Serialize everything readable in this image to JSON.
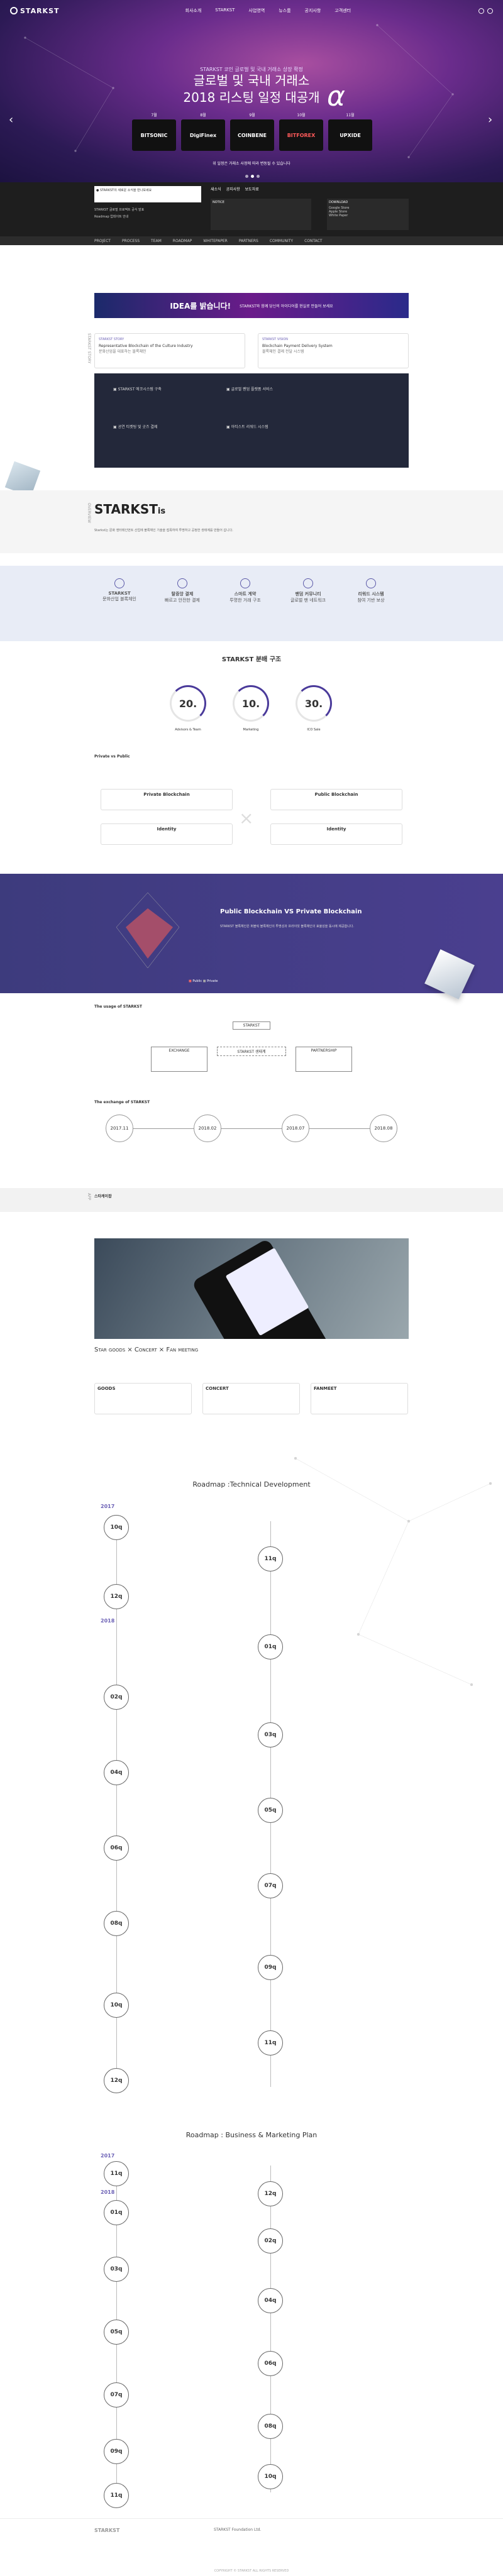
{
  "nav": {
    "logo": "STARKST",
    "menu": [
      "회사소개",
      "STARKST",
      "사업영역",
      "뉴스룸",
      "공지사항",
      "고객센터"
    ]
  },
  "hero": {
    "subtitle": "STARKST 코인 글로벌 및 국내 거래소 상장 확정",
    "title_line1": "글로벌 및 국내 거래소",
    "title_line2": "2018 리스팅 일정 대공개",
    "alpha": "α",
    "exchanges": [
      {
        "tag": "7월",
        "name": "BITSONIC"
      },
      {
        "tag": "8월",
        "name": "DigiFinex"
      },
      {
        "tag": "9월",
        "name": "COINBENE"
      },
      {
        "tag": "10월",
        "name": "BITFOREX"
      },
      {
        "tag": "11월",
        "name": "UPXIDE"
      }
    ],
    "note": "위 일정은 거래소 사정에 따라 변동될 수 있습니다"
  },
  "band": {
    "left_title": "STARKST의 새로운 소식을 만나보세요",
    "news1": "STARKST 글로벌 프로젝트 공식 발표",
    "news2": "Roadmap 업데이트 안내",
    "tab_labels": [
      "새소식",
      "공지사항",
      "보도자료"
    ],
    "notice_title": "NOTICE",
    "download": "DOWNLOAD",
    "links": [
      "Google Store",
      "Apple Store",
      "White Paper"
    ]
  },
  "tabs": [
    "PROJECT",
    "PROCESS",
    "TEAM",
    "ROADMAP",
    "WHITEPAPER",
    "PARTNERS",
    "COMMUNITY",
    "CONTACT"
  ],
  "banner": {
    "logo": "IDEA를 밝습니다!",
    "text": "STARKST와 함께 당신의 아이디어를 현실로 만들어 보세요"
  },
  "story": {
    "label": "STARKST STORY",
    "c1": {
      "tag": "STARKST STORY",
      "title": "Representative Blockchain of the Culture Industry",
      "sub": "문화산업을 대표하는 블록체인"
    },
    "c2": {
      "tag": "STARKST VISION",
      "title": "Blockchain Payment Delivery System",
      "sub": "블록체인 결제 전달 시스템"
    }
  },
  "dark": {
    "items": [
      "STARKST 에코시스템 구축",
      "글로벌 팬덤 플랫폼 서비스",
      "공연 티켓팅 및 굿즈 결제",
      "아티스트 리워드 시스템"
    ]
  },
  "starks": {
    "title": "STARKST",
    "is": "is",
    "label": "OVERVIEW",
    "desc": "Starkst는 문화 엔터테인먼트 산업에 블록체인 기술을 접목하여 투명하고 공정한 생태계를 만들어 갑니다."
  },
  "features": [
    {
      "t": "STARKST",
      "d": "문화산업 블록체인"
    },
    {
      "t": "탈중앙 결제",
      "d": "빠르고 안전한 결제"
    },
    {
      "t": "스마트 계약",
      "d": "투명한 거래 구조"
    },
    {
      "t": "팬덤 커뮤니티",
      "d": "글로벌 팬 네트워크"
    },
    {
      "t": "리워드 시스템",
      "d": "참여 기반 보상"
    }
  ],
  "dist": {
    "title": "STARKST 분배 구조",
    "values": [
      "20.",
      "10.",
      "30."
    ],
    "labels": [
      "Advisors & Team",
      "Marketing",
      "ICO Sale"
    ]
  },
  "chain": {
    "title": "Private vs Public",
    "boxes": [
      "Private Blockchain",
      "Public Blockchain",
      "Identity",
      "Identity"
    ]
  },
  "purple": {
    "title": "Public Blockchain VS Private Blockchain",
    "legend": [
      "Public",
      "Private"
    ],
    "desc": "STARKST 블록체인은 퍼블릭 블록체인의 투명성과 프라이빗 블록체인의 효율성을 동시에 제공합니다."
  },
  "usage": {
    "title": "The usage of STARKST",
    "nodes": [
      "STARKST",
      "STARKST 생태계",
      "EXCHANGE",
      "PARTNERSHIP"
    ]
  },
  "exchange": {
    "title": "The exchange of STARKST",
    "dates": [
      "2017.11",
      "2018.02",
      "2018.07",
      "2018.08"
    ]
  },
  "goods": {
    "label": "APP",
    "heading": "스타케이팝",
    "title": "Star goods × Concert × Fan meeting",
    "cards": [
      "GOODS",
      "CONCERT",
      "FANMEET"
    ]
  },
  "roadmap1": {
    "title": "Roadmap :Technical Development",
    "years": [
      "2017",
      "2018"
    ],
    "nodes": [
      "10q",
      "11q",
      "12q",
      "01q",
      "02q",
      "03q",
      "04q",
      "05q",
      "06q",
      "07q",
      "08q",
      "09q",
      "10q",
      "11q",
      "12q"
    ]
  },
  "roadmap2": {
    "title": "Roadmap : Business & Marketing Plan",
    "years": [
      "2017",
      "2018"
    ],
    "nodes": [
      "11q",
      "12q",
      "01q",
      "02q",
      "03q",
      "04q",
      "05q",
      "06q",
      "07q",
      "08q",
      "09q",
      "10q",
      "11q"
    ]
  },
  "footer": {
    "logo": "STARKST",
    "company": "STARKST Foundation Ltd.",
    "copy": "COPYRIGHT © STARKST ALL RIGHTS RESERVED"
  }
}
